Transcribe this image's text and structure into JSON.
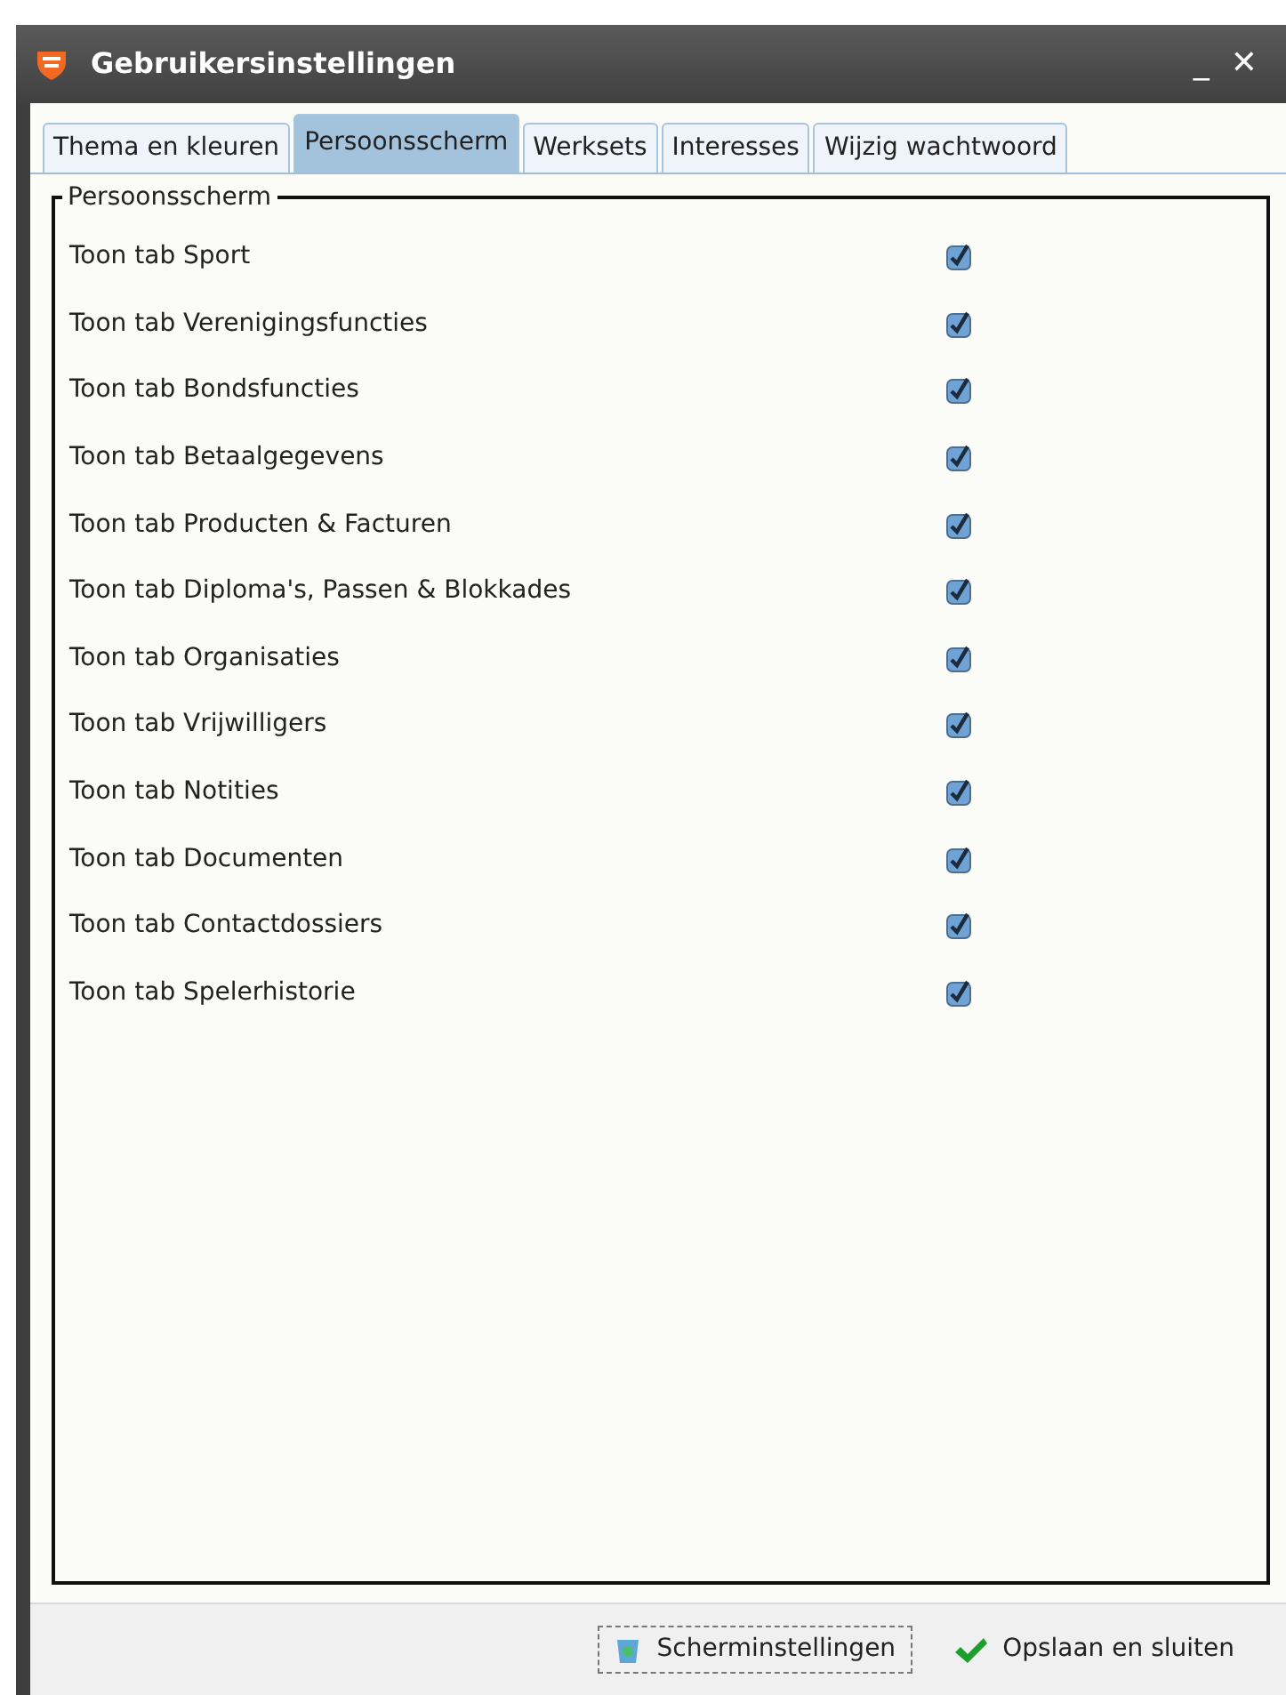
{
  "window": {
    "title": "Gebruikersinstellingen",
    "minimize": "_",
    "close": "✕"
  },
  "tabs": [
    {
      "label": "Thema en kleuren",
      "selected": false
    },
    {
      "label": "Persoonsscherm",
      "selected": true
    },
    {
      "label": "Werksets",
      "selected": false
    },
    {
      "label": "Interesses",
      "selected": false
    },
    {
      "label": "Wijzig wachtwoord",
      "selected": false
    }
  ],
  "group": {
    "title": "Persoonsscherm",
    "options": [
      {
        "label": "Toon tab Sport",
        "checked": true
      },
      {
        "label": "Toon tab Verenigingsfuncties",
        "checked": true
      },
      {
        "label": "Toon tab Bondsfuncties",
        "checked": true
      },
      {
        "label": "Toon tab Betaalgegevens",
        "checked": true
      },
      {
        "label": "Toon tab Producten & Facturen",
        "checked": true
      },
      {
        "label": "Toon tab Diploma's, Passen & Blokkades",
        "checked": true
      },
      {
        "label": "Toon tab Organisaties",
        "checked": true
      },
      {
        "label": "Toon tab Vrijwilligers",
        "checked": true
      },
      {
        "label": "Toon tab Notities",
        "checked": true
      },
      {
        "label": "Toon tab Documenten",
        "checked": true
      },
      {
        "label": "Toon tab Contactdossiers",
        "checked": true
      },
      {
        "label": "Toon tab Spelerhistorie",
        "checked": true
      }
    ]
  },
  "buttons": [
    {
      "label": "Scherminstellingen",
      "kind": "settings"
    },
    {
      "label": "Opslaan en sluiten",
      "kind": "save"
    }
  ]
}
